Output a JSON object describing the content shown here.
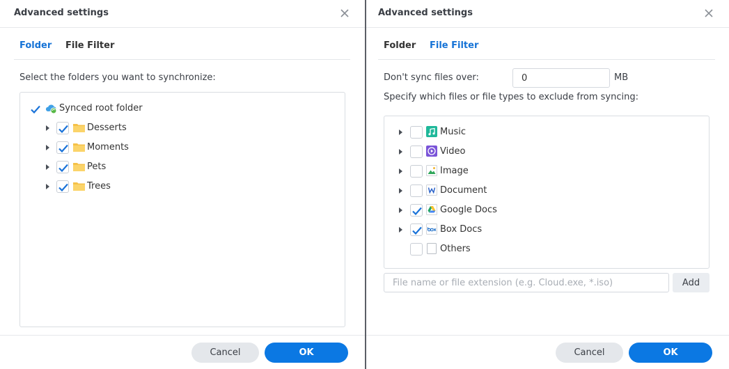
{
  "left": {
    "title": "Advanced settings",
    "tabs": [
      {
        "label": "Folder",
        "active": true
      },
      {
        "label": "File Filter",
        "active": false
      }
    ],
    "instruction": "Select the folders you want to synchronize:",
    "root": {
      "label": "Synced root folder",
      "checked": true,
      "icon": "cloud-sync-icon"
    },
    "folders": [
      {
        "label": "Desserts",
        "checked": true
      },
      {
        "label": "Moments",
        "checked": true
      },
      {
        "label": "Pets",
        "checked": true
      },
      {
        "label": "Trees",
        "checked": true
      }
    ],
    "cancel_label": "Cancel",
    "ok_label": "OK"
  },
  "right": {
    "title": "Advanced settings",
    "tabs": [
      {
        "label": "Folder",
        "active": false
      },
      {
        "label": "File Filter",
        "active": true
      }
    ],
    "size_label": "Don't sync files over:",
    "size_value": "0",
    "size_unit": "MB",
    "exclude_label": "Specify which files or file types to exclude from syncing:",
    "file_types": [
      {
        "label": "Music",
        "checked": false,
        "icon": "music-icon",
        "expandable": true
      },
      {
        "label": "Video",
        "checked": false,
        "icon": "video-icon",
        "expandable": true
      },
      {
        "label": "Image",
        "checked": false,
        "icon": "image-icon",
        "expandable": true
      },
      {
        "label": "Document",
        "checked": false,
        "icon": "document-icon",
        "expandable": true
      },
      {
        "label": "Google Docs",
        "checked": true,
        "icon": "google-drive-icon",
        "expandable": true
      },
      {
        "label": "Box Docs",
        "checked": true,
        "icon": "box-icon",
        "expandable": true
      },
      {
        "label": "Others",
        "checked": false,
        "icon": "generic-file-icon",
        "expandable": false
      }
    ],
    "ext_placeholder": "File name or file extension (e.g. Cloud.exe, *.iso)",
    "add_label": "Add",
    "cancel_label": "Cancel",
    "ok_label": "OK"
  },
  "colors": {
    "accent": "#0b78e3",
    "tab_active": "#1673d6",
    "check": "#1a73d9",
    "folder": "#f5c148"
  }
}
